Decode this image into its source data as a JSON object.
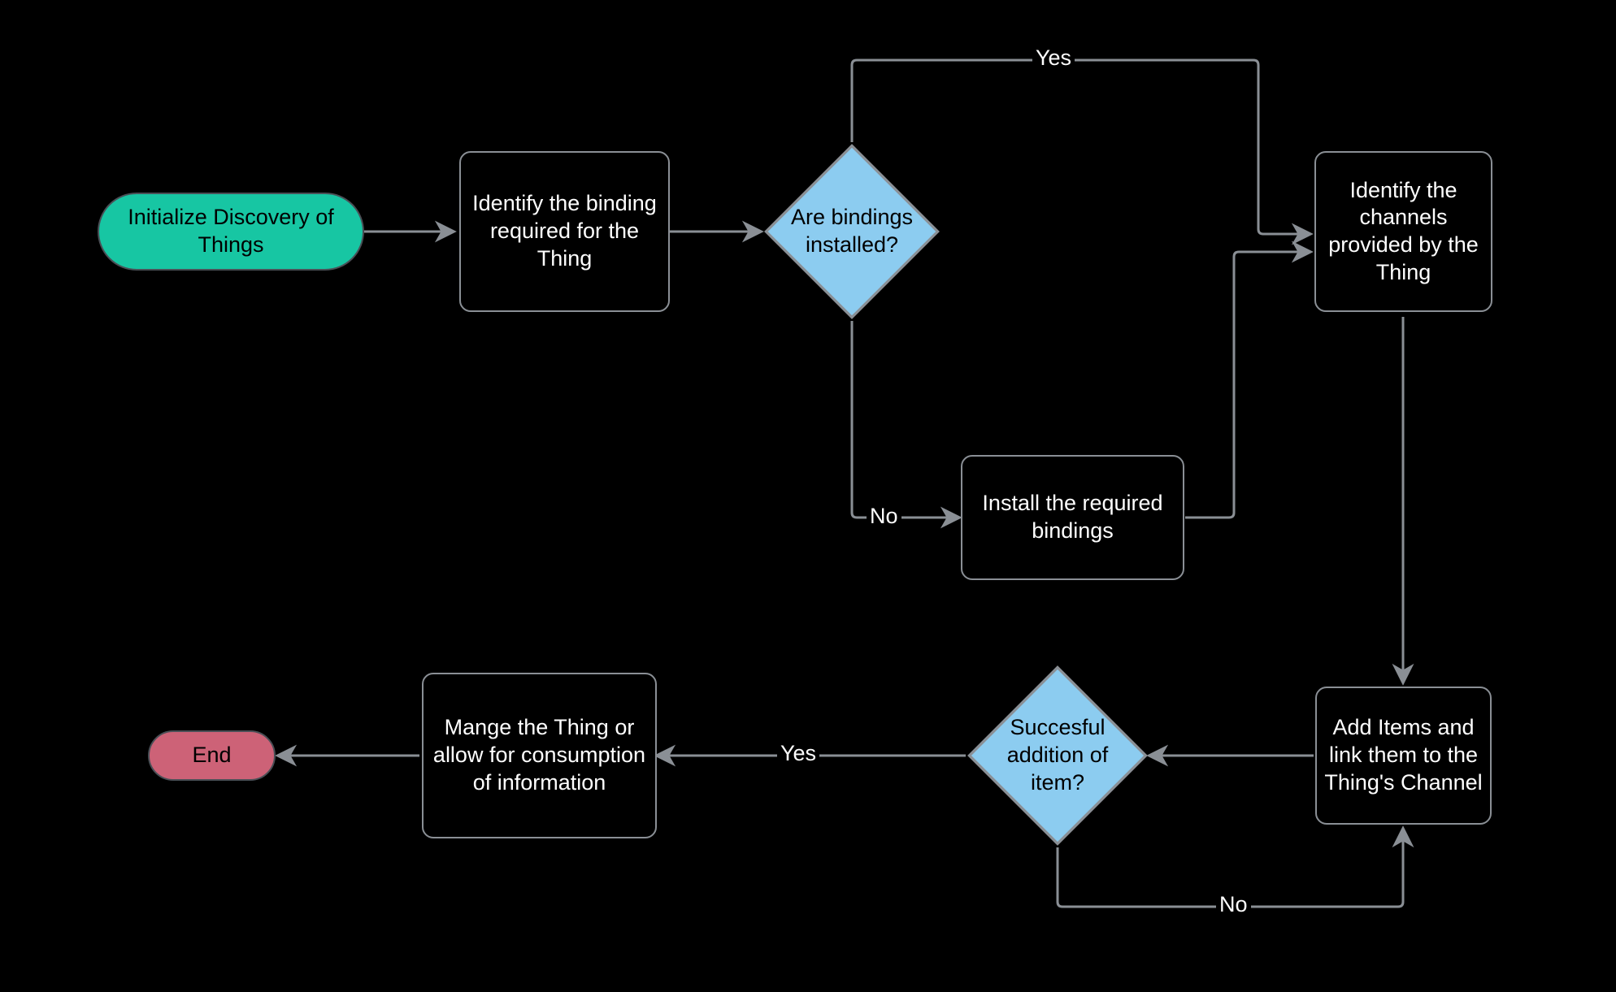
{
  "nodes": {
    "start": {
      "label": "Initialize Discovery of Things"
    },
    "identify_binding": {
      "label": "Identify the binding required for the Thing"
    },
    "decision_installed": {
      "label": "Are bindings installed?"
    },
    "install_bindings": {
      "label": "Install the required bindings"
    },
    "identify_channels": {
      "label": "Identify the channels provided by the Thing"
    },
    "add_items": {
      "label": "Add Items and link them to the Thing's Channel"
    },
    "decision_success": {
      "label": "Succesful addition of item?"
    },
    "manage": {
      "label": "Mange the Thing or allow for consumption of information"
    },
    "end": {
      "label": "End"
    }
  },
  "edge_labels": {
    "yes_top": "Yes",
    "no_left": "No",
    "yes_mid": "Yes",
    "no_bottom": "No"
  },
  "chart_data": {
    "type": "flowchart",
    "nodes": [
      {
        "id": "start",
        "type": "terminator",
        "label": "Initialize Discovery of Things"
      },
      {
        "id": "identify_binding",
        "type": "process",
        "label": "Identify the binding required for the Thing"
      },
      {
        "id": "decision_installed",
        "type": "decision",
        "label": "Are bindings installed?"
      },
      {
        "id": "install_bindings",
        "type": "process",
        "label": "Install the required bindings"
      },
      {
        "id": "identify_channels",
        "type": "process",
        "label": "Identify the channels provided by the Thing"
      },
      {
        "id": "add_items",
        "type": "process",
        "label": "Add Items and link them to the Thing's Channel"
      },
      {
        "id": "decision_success",
        "type": "decision",
        "label": "Succesful addition of item?"
      },
      {
        "id": "manage",
        "type": "process",
        "label": "Mange the Thing or allow for consumption of information"
      },
      {
        "id": "end",
        "type": "terminator",
        "label": "End"
      }
    ],
    "edges": [
      {
        "from": "start",
        "to": "identify_binding"
      },
      {
        "from": "identify_binding",
        "to": "decision_installed"
      },
      {
        "from": "decision_installed",
        "to": "identify_channels",
        "label": "Yes"
      },
      {
        "from": "decision_installed",
        "to": "install_bindings",
        "label": "No"
      },
      {
        "from": "install_bindings",
        "to": "identify_channels"
      },
      {
        "from": "identify_channels",
        "to": "add_items"
      },
      {
        "from": "add_items",
        "to": "decision_success"
      },
      {
        "from": "decision_success",
        "to": "manage",
        "label": "Yes"
      },
      {
        "from": "decision_success",
        "to": "add_items",
        "label": "No"
      },
      {
        "from": "manage",
        "to": "end"
      }
    ]
  }
}
